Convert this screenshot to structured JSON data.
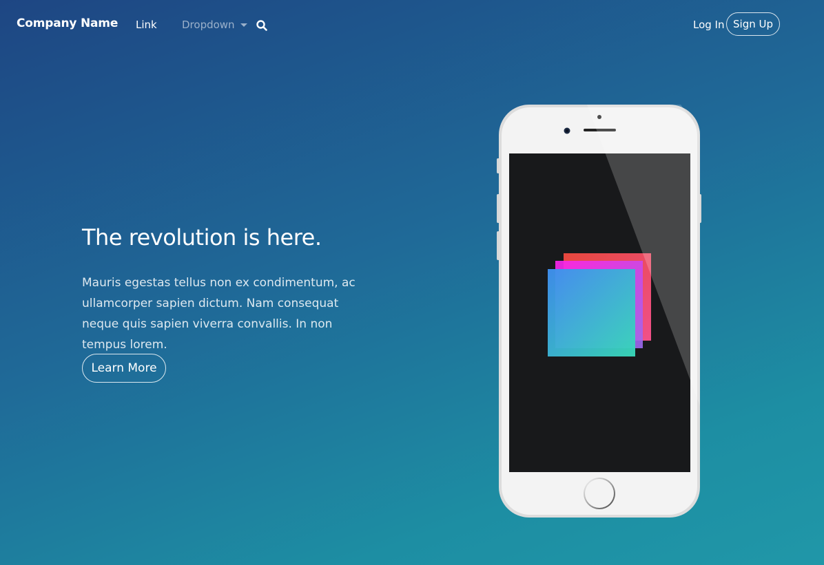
{
  "navbar": {
    "brand": "Company Name",
    "link": "Link",
    "dropdown": "Dropdown",
    "search_icon": "search-icon",
    "login": "Log In",
    "signup": "Sign Up"
  },
  "hero": {
    "title": "The revolution is here.",
    "text": "Mauris egestas tellus non ex condimentum, ac ullamcorper sapien dictum. Nam consequat neque quis sapien viverra convallis. In non tempus lorem.",
    "button": "Learn More"
  },
  "colors": {
    "background_start": "#1e4683",
    "background_end": "#2097a8",
    "phone_body": "#f2f2f2",
    "phone_screen": "#18191b",
    "logo_red": "#e94e4e",
    "logo_magenta": "#ee22ee",
    "logo_blue": "#3f92ec",
    "logo_teal": "#36d3c0"
  }
}
